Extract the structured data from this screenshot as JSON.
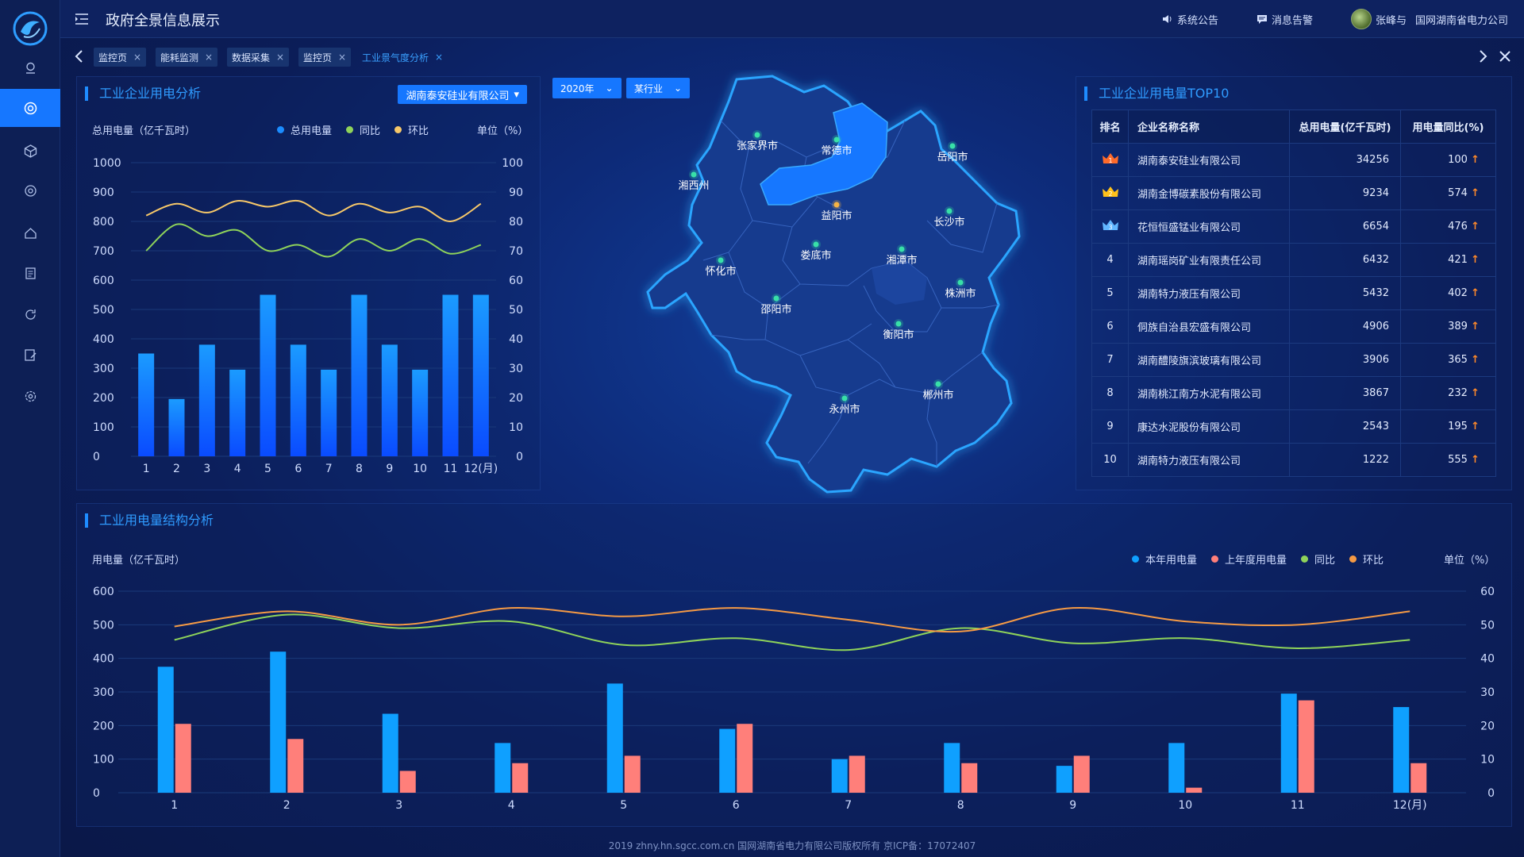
{
  "app": {
    "title": "政府全景信息展示"
  },
  "header": {
    "announcement": "系统公告",
    "alerts": "消息告警",
    "user": "张峰与",
    "org": "国网湖南省电力公司"
  },
  "tabs": [
    {
      "label": "监控页",
      "active": false
    },
    {
      "label": "能耗监测",
      "active": false
    },
    {
      "label": "数据采集",
      "active": false
    },
    {
      "label": "监控页",
      "active": false
    },
    {
      "label": "工业景气度分析",
      "active": true
    }
  ],
  "sidebar": {
    "icons": [
      "location-icon",
      "target-icon",
      "cube-icon",
      "settings-cog-icon",
      "home-icon",
      "document-icon",
      "refresh-icon",
      "edit-icon",
      "gear-icon"
    ],
    "active_index": 1
  },
  "panel_left": {
    "title": "工业企业用电分析",
    "company": "湖南泰安硅业有限公司",
    "y_label": "总用电量（亿千瓦时）",
    "unit_label": "单位（%）",
    "legend": [
      "总用电量",
      "同比",
      "环比"
    ],
    "colors": {
      "bar": "#1b8cff",
      "yoy": "#8fd35a",
      "mom": "#f7c869"
    }
  },
  "map": {
    "year": "2020年",
    "industry": "某行业",
    "cities": [
      {
        "name": "张家界市"
      },
      {
        "name": "常德市"
      },
      {
        "name": "岳阳市"
      },
      {
        "name": "湘西州"
      },
      {
        "name": "益阳市"
      },
      {
        "name": "长沙市"
      },
      {
        "name": "娄底市"
      },
      {
        "name": "湘潭市"
      },
      {
        "name": "怀化市"
      },
      {
        "name": "株洲市"
      },
      {
        "name": "邵阳市"
      },
      {
        "name": "衡阳市"
      },
      {
        "name": "永州市"
      },
      {
        "name": "郴州市"
      }
    ],
    "highlight_city": "益阳市"
  },
  "top10": {
    "title": "工业企业用电量TOP10",
    "headers": [
      "排名",
      "企业名称名称",
      "总用电量(亿千瓦时)",
      "用电量同比(%)"
    ],
    "rows": [
      {
        "rank": "1",
        "name": "湖南泰安硅业有限公司",
        "total": "34256",
        "yoy": "100"
      },
      {
        "rank": "2",
        "name": "湖南金博碳素股份有限公司",
        "total": "9234",
        "yoy": "574"
      },
      {
        "rank": "3",
        "name": "花恒恒盛锰业有限公司",
        "total": "6654",
        "yoy": "476"
      },
      {
        "rank": "4",
        "name": "湖南瑶岗矿业有限责任公司",
        "total": "6432",
        "yoy": "421"
      },
      {
        "rank": "5",
        "name": "湖南特力液压有限公司",
        "total": "5432",
        "yoy": "402"
      },
      {
        "rank": "6",
        "name": "侗族自治县宏盛有限公司",
        "total": "4906",
        "yoy": "389"
      },
      {
        "rank": "7",
        "name": "湖南醴陵旗滨玻璃有限公司",
        "total": "3906",
        "yoy": "365"
      },
      {
        "rank": "8",
        "name": "湖南桃江南方水泥有限公司",
        "total": "3867",
        "yoy": "232"
      },
      {
        "rank": "9",
        "name": "康达水泥股份有限公司",
        "total": "2543",
        "yoy": "195"
      },
      {
        "rank": "10",
        "name": "湖南特力液压有限公司",
        "total": "1222",
        "yoy": "555"
      }
    ],
    "arrow": "↑"
  },
  "panel_bottom": {
    "title": "工业用电量结构分析",
    "y_label": "用电量（亿千瓦时）",
    "unit_label": "单位（%）",
    "legend": [
      "本年用电量",
      "上年度用电量",
      "同比",
      "环比"
    ],
    "colors": {
      "current": "#0fa0ff",
      "last": "#ff7f7a",
      "yoy": "#8fd35a",
      "mom": "#f59a45"
    }
  },
  "chart_data": [
    {
      "type": "bar",
      "categories": [
        "1",
        "2",
        "3",
        "4",
        "5",
        "6",
        "7",
        "8",
        "9",
        "10",
        "11",
        "12(月)"
      ],
      "ylabel": "总用电量（亿千瓦时）",
      "ylim": [
        0,
        1000
      ],
      "y2lim": [
        0,
        100
      ],
      "yticks": [
        "0",
        "100",
        "200",
        "300",
        "400",
        "500",
        "600",
        "700",
        "800",
        "900",
        "1000"
      ],
      "y2ticks": [
        "0",
        "10",
        "20",
        "30",
        "40",
        "50",
        "60",
        "70",
        "80",
        "90",
        "100"
      ],
      "series": [
        {
          "name": "总用电量",
          "type": "bar",
          "values": [
            350,
            195,
            380,
            295,
            550,
            380,
            295,
            550,
            380,
            295,
            550,
            550
          ]
        },
        {
          "name": "同比",
          "type": "line",
          "axis": "right",
          "values": [
            70,
            79,
            75,
            77,
            70,
            72,
            68,
            74,
            70,
            74,
            69,
            72
          ]
        },
        {
          "name": "环比",
          "type": "line",
          "axis": "right",
          "values": [
            82,
            86,
            83,
            87,
            85,
            87,
            82,
            86,
            83,
            85,
            80,
            86
          ]
        }
      ],
      "legend_position": "top-right",
      "grid": true
    },
    {
      "type": "bar",
      "categories": [
        "1",
        "2",
        "3",
        "4",
        "5",
        "6",
        "7",
        "8",
        "9",
        "10",
        "11",
        "12(月)"
      ],
      "ylabel": "用电量（亿千瓦时）",
      "ylim": [
        0,
        600
      ],
      "y2lim": [
        0,
        60
      ],
      "yticks": [
        "0",
        "100",
        "200",
        "300",
        "400",
        "500",
        "600"
      ],
      "y2ticks": [
        "0",
        "10",
        "20",
        "30",
        "40",
        "50",
        "60"
      ],
      "series": [
        {
          "name": "本年用电量",
          "type": "bar",
          "values": [
            375,
            420,
            235,
            148,
            325,
            190,
            100,
            148,
            80,
            148,
            295,
            255
          ]
        },
        {
          "name": "上年度用电量",
          "type": "bar",
          "values": [
            205,
            160,
            65,
            88,
            110,
            205,
            110,
            88,
            110,
            15,
            275,
            88
          ]
        },
        {
          "name": "同比",
          "type": "line",
          "axis": "right",
          "values": [
            45.5,
            53,
            49,
            51,
            44,
            46,
            42.5,
            49,
            44.5,
            46,
            43,
            45.5
          ]
        },
        {
          "name": "环比",
          "type": "line",
          "axis": "right",
          "values": [
            49.5,
            54,
            50,
            55,
            52.5,
            55,
            51.5,
            48,
            55,
            51,
            50,
            54
          ]
        }
      ],
      "legend_position": "top-right",
      "grid": true
    }
  ],
  "footer": {
    "text": "2019 zhny.hn.sgcc.com.cn 国网湖南省电力有限公司版权所有 京ICP备：17072407"
  }
}
